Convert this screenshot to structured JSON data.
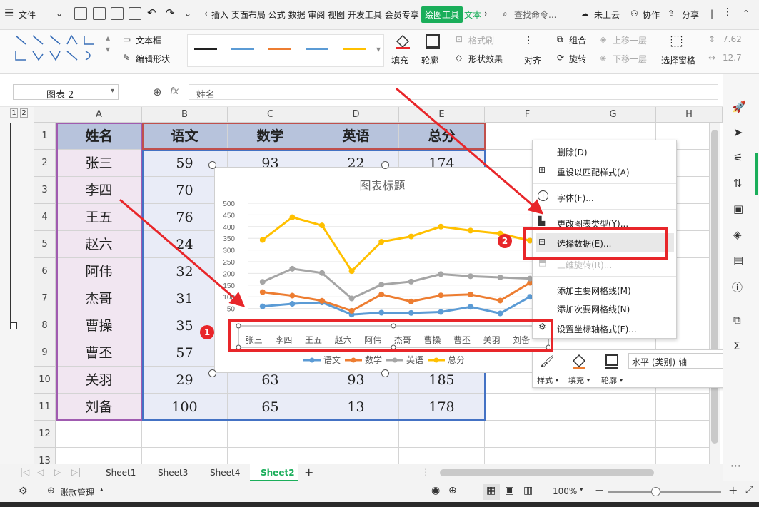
{
  "tabs": {
    "file": "文件",
    "menu_items": "插入 页面布局 公式 数据 审阅 视图 开发工具 会员专享",
    "drawing_tools": "绘图工具",
    "text_tools": "文本",
    "search": "查找命令...",
    "cloud": "未上云",
    "collab": "协作",
    "share": "分享"
  },
  "ribbon": {
    "textbox": "文本框",
    "edit_shape": "编辑形状",
    "fill": "填充",
    "outline": "轮廓",
    "format_brush": "格式刷",
    "shape_effect": "形状效果",
    "align": "对齐",
    "group": "组合",
    "rotate": "旋转",
    "bring_forward": "上移一层",
    "send_backward": "下移一层",
    "selection_pane": "选择窗格",
    "size1": "7.62",
    "size2": "12.7"
  },
  "formula": {
    "name_box": "图表 2",
    "fx": "fx",
    "content": "姓名"
  },
  "columns": [
    "A",
    "B",
    "C",
    "D",
    "E",
    "F",
    "G",
    "H"
  ],
  "rows": [
    "1",
    "2",
    "3",
    "4",
    "5",
    "6",
    "7",
    "8",
    "9",
    "10",
    "11",
    "12",
    "13"
  ],
  "outline_levels": [
    "1",
    "2"
  ],
  "table": {
    "headers": [
      "姓名",
      "语文",
      "数学",
      "英语",
      "总分"
    ],
    "data": [
      [
        "张三",
        "59",
        "93",
        "22",
        "174"
      ],
      [
        "李四",
        "70",
        "",
        "",
        ""
      ],
      [
        "王五",
        "76",
        "",
        "",
        ""
      ],
      [
        "赵六",
        "24",
        "",
        "",
        ""
      ],
      [
        "阿伟",
        "32",
        "",
        "",
        ""
      ],
      [
        "杰哥",
        "31",
        "",
        "",
        ""
      ],
      [
        "曹操",
        "35",
        "",
        "",
        ""
      ],
      [
        "曹丕",
        "57",
        "",
        "",
        ""
      ],
      [
        "关羽",
        "29",
        "63",
        "93",
        "185"
      ],
      [
        "刘备",
        "100",
        "65",
        "13",
        "178"
      ]
    ]
  },
  "chart_data": {
    "type": "line",
    "title": "图表标题",
    "categories": [
      "张三",
      "李四",
      "王五",
      "赵六",
      "阿伟",
      "杰哥",
      "曹操",
      "曹丕",
      "关羽",
      "刘备"
    ],
    "ylim": [
      0,
      500
    ],
    "yticks": [
      "500",
      "450",
      "400",
      "350",
      "300",
      "250",
      "200",
      "150",
      "100",
      "50"
    ],
    "series": [
      {
        "name": "语文",
        "values": [
          59,
          70,
          76,
          24,
          32,
          31,
          35,
          57,
          29,
          100
        ],
        "color": "#5b9bd5"
      },
      {
        "name": "数学",
        "values": [
          120,
          105,
          83,
          40,
          110,
          80,
          106,
          110,
          84,
          160
        ],
        "color": "#ed7d31"
      },
      {
        "name": "英语",
        "values": [
          164,
          220,
          202,
          93,
          152,
          165,
          197,
          188,
          183,
          178
        ],
        "color": "#a5a5a5"
      },
      {
        "name": "总分",
        "values": [
          343,
          440,
          405,
          210,
          335,
          358,
          400,
          383,
          370,
          340
        ],
        "color": "#ffc000"
      }
    ],
    "legend": "bottom",
    "grid": true
  },
  "context_menu": {
    "items": [
      "删除(D)",
      "重设以匹配样式(A)",
      "字体(F)...",
      "更改图表类型(Y)...",
      "选择数据(E)...",
      "三维旋转(R)...",
      "添加主要网格线(M)",
      "添加次要网格线(N)",
      "设置坐标轴格式(F)..."
    ]
  },
  "format_bar": {
    "style": "样式",
    "fill": "填充",
    "outline": "轮廓",
    "axis_select": "水平 (类别) 轴"
  },
  "annotations": {
    "badge1": "1",
    "badge2": "2"
  },
  "sheets": [
    "Sheet1",
    "Sheet3",
    "Sheet4",
    "Sheet2"
  ],
  "status": {
    "account": "账款管理",
    "zoom": "100%"
  },
  "colors": {
    "accent_green": "#1aae5a",
    "highlight_red": "#e8262a",
    "header_fill": "#b7c3dc",
    "name_col_fill": "#f1e6f1",
    "data_fill": "#e9ecf7"
  }
}
